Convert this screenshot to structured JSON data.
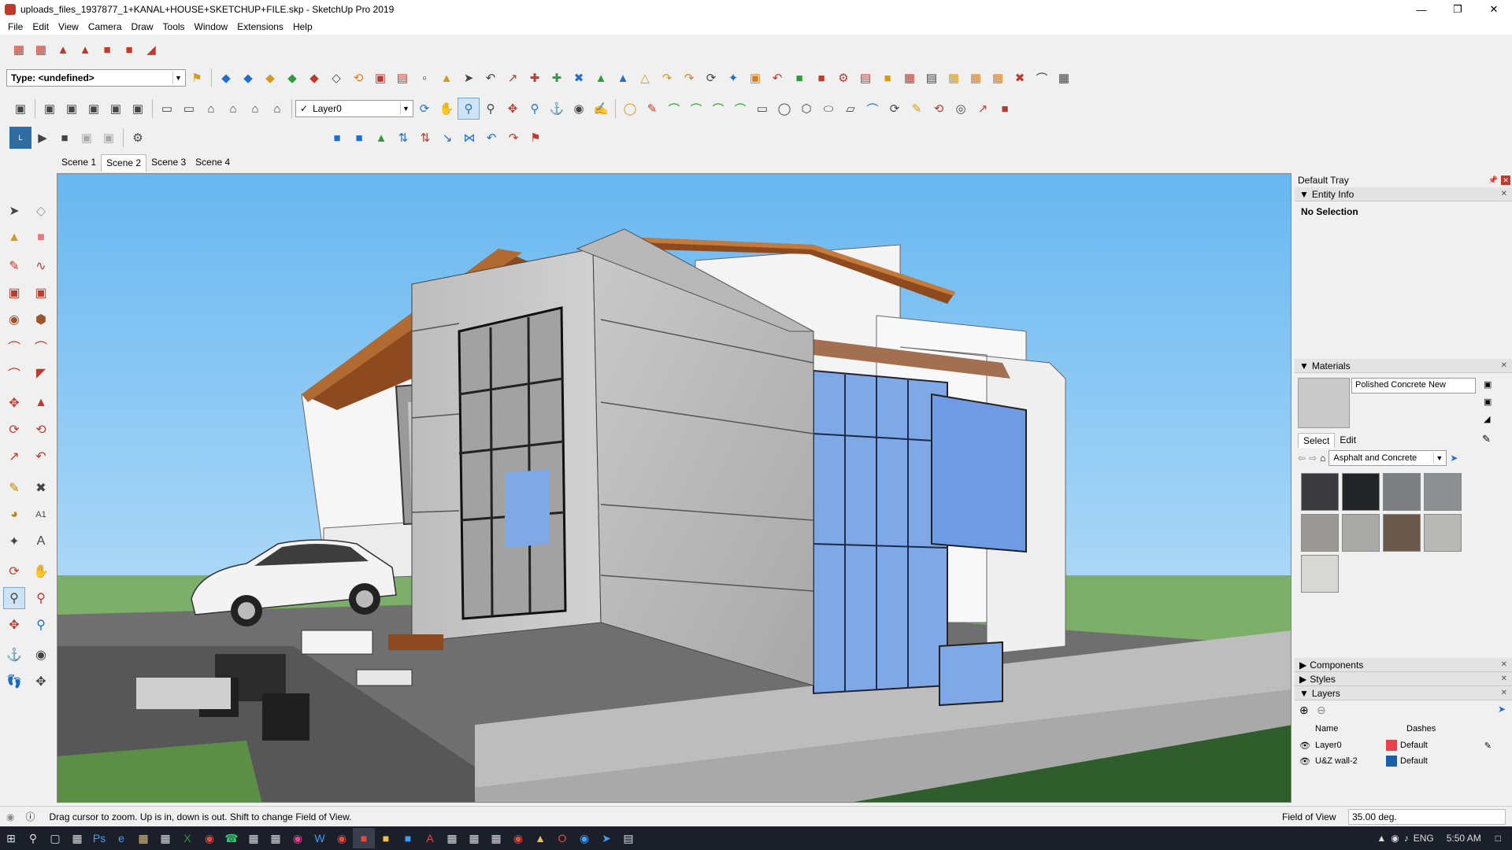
{
  "window": {
    "title": "uploads_files_1937877_1+KANAL+HOUSE+SKETCHUP+FILE.skp - SketchUp Pro 2019"
  },
  "menu": [
    "File",
    "Edit",
    "View",
    "Camera",
    "Draw",
    "Tools",
    "Window",
    "Extensions",
    "Help"
  ],
  "toolbar": {
    "type_dropdown": "Type: <undefined>",
    "layer_dropdown": "Layer0",
    "layer_check": "✓"
  },
  "scenes": [
    "Scene 1",
    "Scene 2",
    "Scene 3",
    "Scene 4"
  ],
  "active_scene_index": 1,
  "tray": {
    "title": "Default Tray",
    "entity_info": {
      "header": "Entity Info",
      "selection": "No Selection"
    },
    "materials": {
      "header": "Materials",
      "name_value": "Polished Concrete New",
      "tab_select": "Select",
      "tab_edit": "Edit",
      "library": "Asphalt and Concrete",
      "swatch_colors": [
        "#3b3a3e",
        "#222426",
        "#7d7f82",
        "#8d8f91",
        "#9a9997",
        "#a9aaa7",
        "#6b5a4b",
        "#b9bab8",
        "#d8d8d6"
      ]
    },
    "components": "Components",
    "styles": "Styles",
    "layers": {
      "header": "Layers",
      "col_name": "Name",
      "col_dashes": "Dashes",
      "rows": [
        {
          "name": "Layer0",
          "dashes": "Default",
          "color": "#e8414b"
        },
        {
          "name": "U&Z wall-2",
          "dashes": "Default",
          "color": "#1c5fa8"
        }
      ]
    }
  },
  "status": {
    "message": "Drag cursor to zoom.  Up is in, down is out. Shift to change Field of View.",
    "measure_label": "Field of View",
    "measure_value": "35.00 deg."
  },
  "taskbar": {
    "lang": "ENG",
    "time": "5:50 AM"
  }
}
